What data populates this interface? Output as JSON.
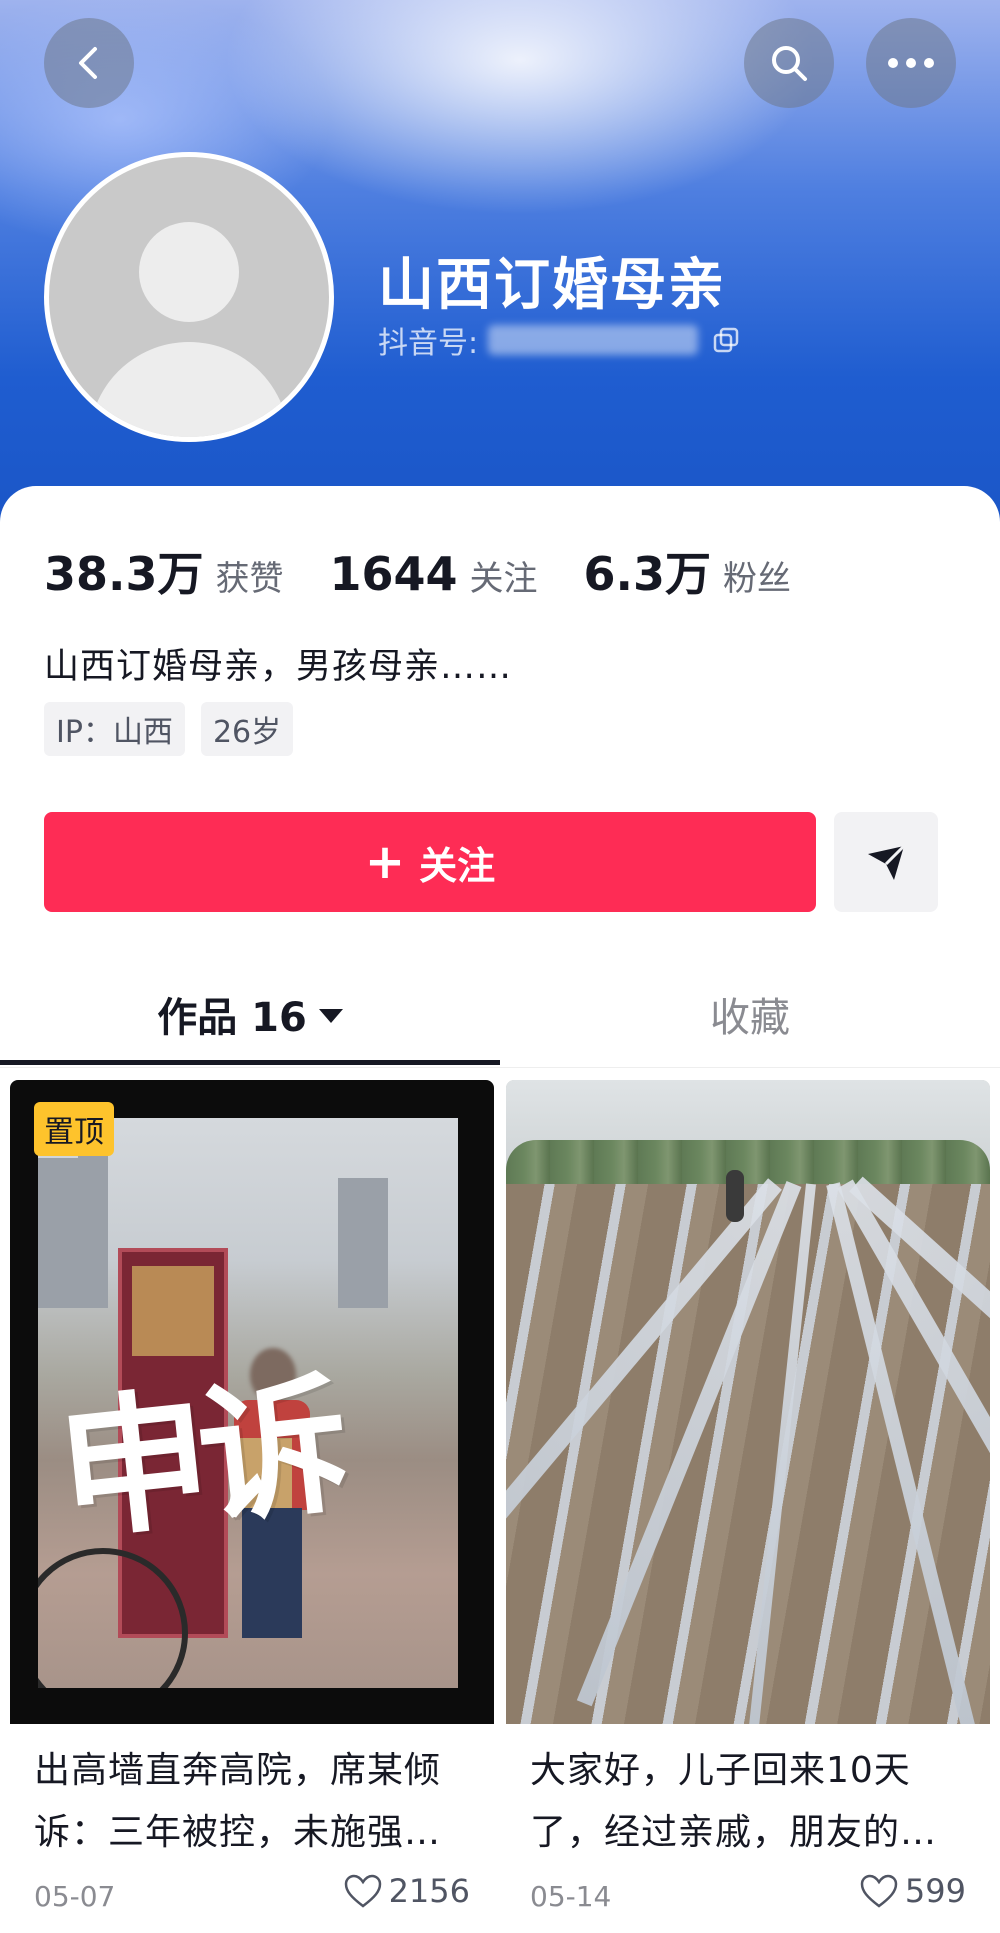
{
  "header": {
    "nickname": "山西订婚母亲",
    "douyin_id_label": "抖音号:",
    "icons": {
      "back": "back-chevron-icon",
      "search": "search-icon",
      "more": "more-dots-icon",
      "copy": "copy-icon"
    }
  },
  "stats": [
    {
      "value": "38.3万",
      "label": "获赞"
    },
    {
      "value": "1644",
      "label": "关注"
    },
    {
      "value": "6.3万",
      "label": "粉丝"
    }
  ],
  "bio": "山西订婚母亲，男孩母亲……",
  "tags": [
    "IP：山西",
    "26岁"
  ],
  "actions": {
    "follow_label": "关注",
    "follow_icon": "plus-icon",
    "share_icon": "send-icon"
  },
  "colors": {
    "accent": "#fe2c55",
    "pin_badge": "#fec32c",
    "header_blue": "#1f5dd0"
  },
  "tabs": [
    {
      "label": "作品 16",
      "active": true
    },
    {
      "label": "收藏",
      "active": false
    }
  ],
  "videos": [
    {
      "pinned_label": "置顶",
      "overlay_text": "申诉",
      "title": "出高墙直奔高院，席某倾诉：三年被控，未施强…",
      "date": "05-07",
      "likes": "2156"
    },
    {
      "title": "大家好，儿子回来10天了，经过亲戚，朋友的…",
      "date": "05-14",
      "likes": "599"
    }
  ]
}
